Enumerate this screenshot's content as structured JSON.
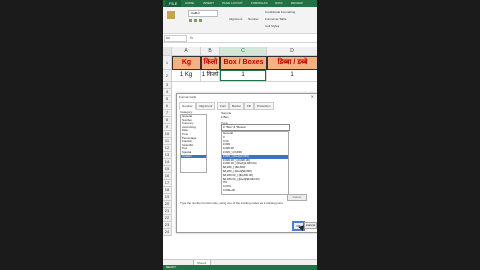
{
  "ribbon": {
    "file_tab": "FILE",
    "tabs": [
      "HOME",
      "INSERT",
      "PAGE LAYOUT",
      "FORMULAS",
      "DATA",
      "REVIEW"
    ],
    "font_name": "Calibri",
    "alignment_label": "Alignment",
    "number_label": "Number",
    "conditional_formatting": "Conditional Formatting",
    "format_as_table": "Format as Table",
    "cell_styles": "Cell Styles"
  },
  "formula_bar": {
    "name_box": "C2",
    "fx": "fx"
  },
  "sheet": {
    "columns": [
      "A",
      "B",
      "C",
      "D"
    ],
    "selected_column": "C",
    "rows": [
      "1",
      "2"
    ],
    "header_row": [
      "Kg",
      "किलो",
      "Box / Boxes",
      "डिब्बा / डब्बे"
    ],
    "data_row": [
      "1 Kg",
      "1 किलो",
      "1",
      "1"
    ],
    "extra_rows": [
      "3",
      "4",
      "5",
      "6",
      "7",
      "8",
      "9",
      "10",
      "11",
      "12",
      "13",
      "14",
      "15",
      "16",
      "17",
      "18",
      "19",
      "20",
      "21",
      "22",
      "23",
      "24"
    ]
  },
  "dialog": {
    "title": "Format Cells",
    "close": "✕",
    "tabs": [
      "Number",
      "Alignment",
      "Font",
      "Border",
      "Fill",
      "Protection"
    ],
    "category_label": "Category:",
    "categories": [
      "General",
      "Number",
      "Currency",
      "Accounting",
      "Date",
      "Time",
      "Percentage",
      "Fraction",
      "Scientific",
      "Text",
      "Special",
      "Custom"
    ],
    "selected_category": "Custom",
    "sample_label": "Sample",
    "sample_value": "1 Box",
    "type_label": "Type:",
    "type_value": "# \"Box\";# \"Boxes\"",
    "formats": [
      "General",
      "0",
      "0.00",
      "#,##0",
      "#,##0.00",
      "#,##0_);(#,##0)",
      "#,##0_);[Red](#,##0)",
      "#,##0.00_);(#,##0.00)",
      "#,##0.00_);[Red](#,##0.00)",
      "$#,##0_);($#,##0)",
      "$#,##0_);[Red]($#,##0)",
      "$#,##0.00_);($#,##0.00)",
      "$#,##0.00_);[Red]($#,##0.00)",
      "0%",
      "0.00%",
      "0.00E+00"
    ],
    "delete_label": "Delete",
    "hint": "Type the number format code, using one of the existing codes as a starting point.",
    "ok_label": "OK",
    "cancel_label": "Cancel"
  },
  "footer": {
    "sheet_tab": "Sheet1",
    "status": "READY"
  }
}
